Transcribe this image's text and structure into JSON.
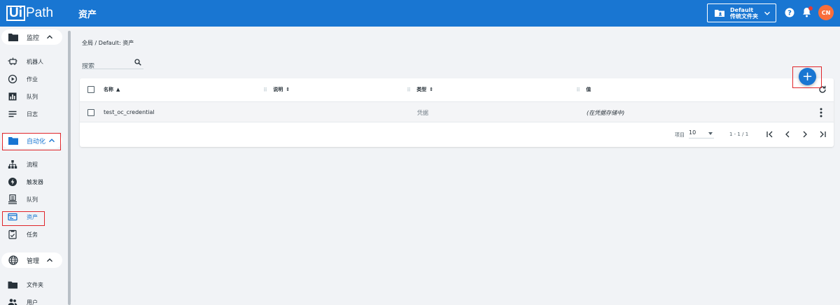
{
  "header": {
    "logo_ui": "Ui",
    "logo_path": "Path",
    "title": "资产",
    "folder_line1": "Default",
    "folder_line2": "传统文件夹",
    "avatar_initials": "CN"
  },
  "sidebar": {
    "sections": [
      {
        "label": "监控",
        "icon": "folder-icon"
      },
      {
        "label": "自动化",
        "icon": "folder-icon"
      },
      {
        "label": "管理",
        "icon": "globe-icon"
      }
    ],
    "monitor_items": [
      {
        "label": "机器人",
        "icon": "robot-icon"
      },
      {
        "label": "作业",
        "icon": "play-circle-icon"
      },
      {
        "label": "队列",
        "icon": "bar-chart-icon"
      },
      {
        "label": "日志",
        "icon": "list-lines-icon"
      }
    ],
    "automation_items": [
      {
        "label": "流程",
        "icon": "hierarchy-icon"
      },
      {
        "label": "触发器",
        "icon": "lightning-icon"
      },
      {
        "label": "队列",
        "icon": "queue-stack-icon"
      },
      {
        "label": "资产",
        "icon": "asset-card-icon"
      },
      {
        "label": "任务",
        "icon": "task-clipboard-icon"
      }
    ],
    "admin_items": [
      {
        "label": "文件夹",
        "icon": "folder-icon"
      },
      {
        "label": "用户",
        "icon": "users-icon"
      }
    ]
  },
  "main": {
    "breadcrumb": "全局 / Default: 资产",
    "search_placeholder": "搜索",
    "columns": [
      "名称",
      "说明",
      "类型",
      "值"
    ],
    "rows": [
      {
        "name": "test_oc_credential",
        "description": "",
        "type": "凭据",
        "value": "(在凭据存储中)"
      }
    ],
    "pager": {
      "items_label": "项目",
      "page_size": "10",
      "range": "1 - 1 / 1"
    }
  },
  "colors": {
    "brand": "#1976d2",
    "highlight_box": "#e0252a",
    "avatar": "#fa6e3b"
  }
}
